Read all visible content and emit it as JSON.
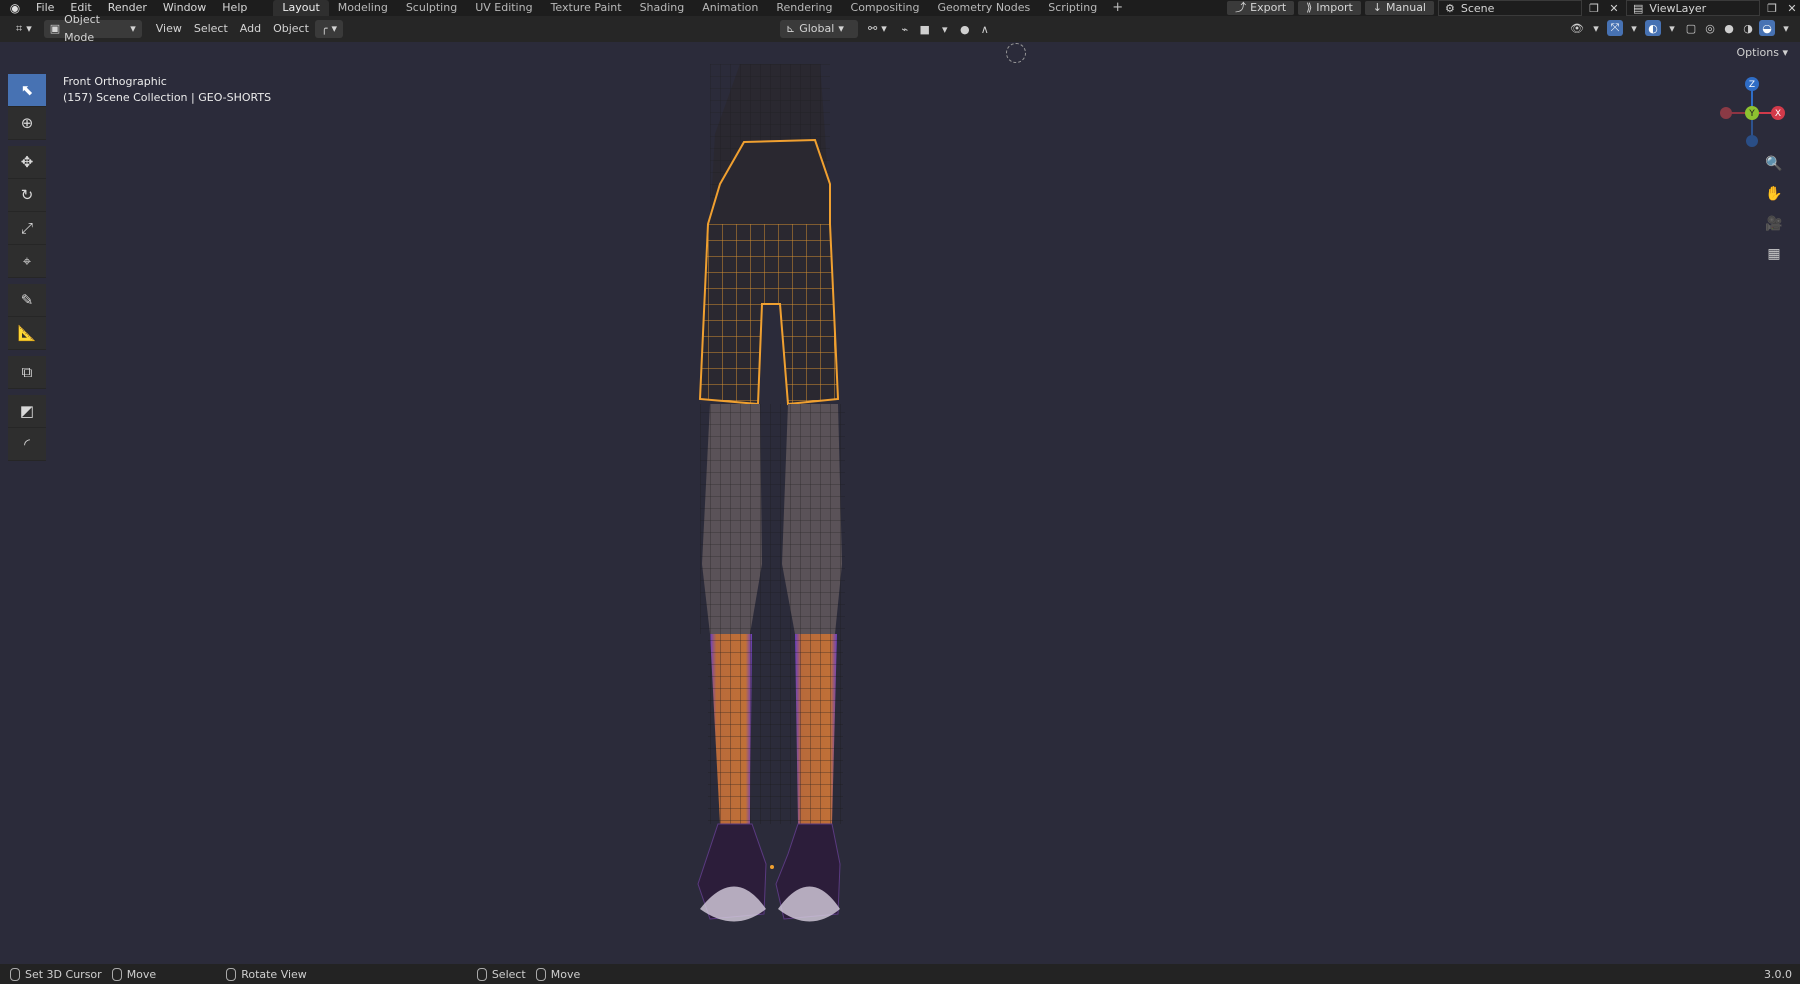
{
  "menu": [
    "File",
    "Edit",
    "Render",
    "Window",
    "Help"
  ],
  "workspaces": [
    "Layout",
    "Modeling",
    "Sculpting",
    "UV Editing",
    "Texture Paint",
    "Shading",
    "Animation",
    "Rendering",
    "Compositing",
    "Geometry Nodes",
    "Scripting"
  ],
  "active_workspace": "Layout",
  "top_right": {
    "export": "Export",
    "import": "Import",
    "manual": "Manual",
    "scene": "Scene",
    "view_layer": "ViewLayer"
  },
  "header": {
    "mode": "Object Mode",
    "view": "View",
    "select": "Select",
    "add": "Add",
    "object": "Object",
    "orientation": "Global"
  },
  "options_label": "Options",
  "viewport": {
    "view_name": "Front Orthographic",
    "collection_info": "(157) Scene Collection | GEO-SHORTS"
  },
  "gizmo": {
    "z": "Z",
    "y": "Y",
    "x": "X"
  },
  "status_bar": {
    "set_cursor": "Set 3D Cursor",
    "move1": "Move",
    "rotate": "Rotate View",
    "select": "Select",
    "move2": "Move",
    "version": "3.0.0"
  }
}
